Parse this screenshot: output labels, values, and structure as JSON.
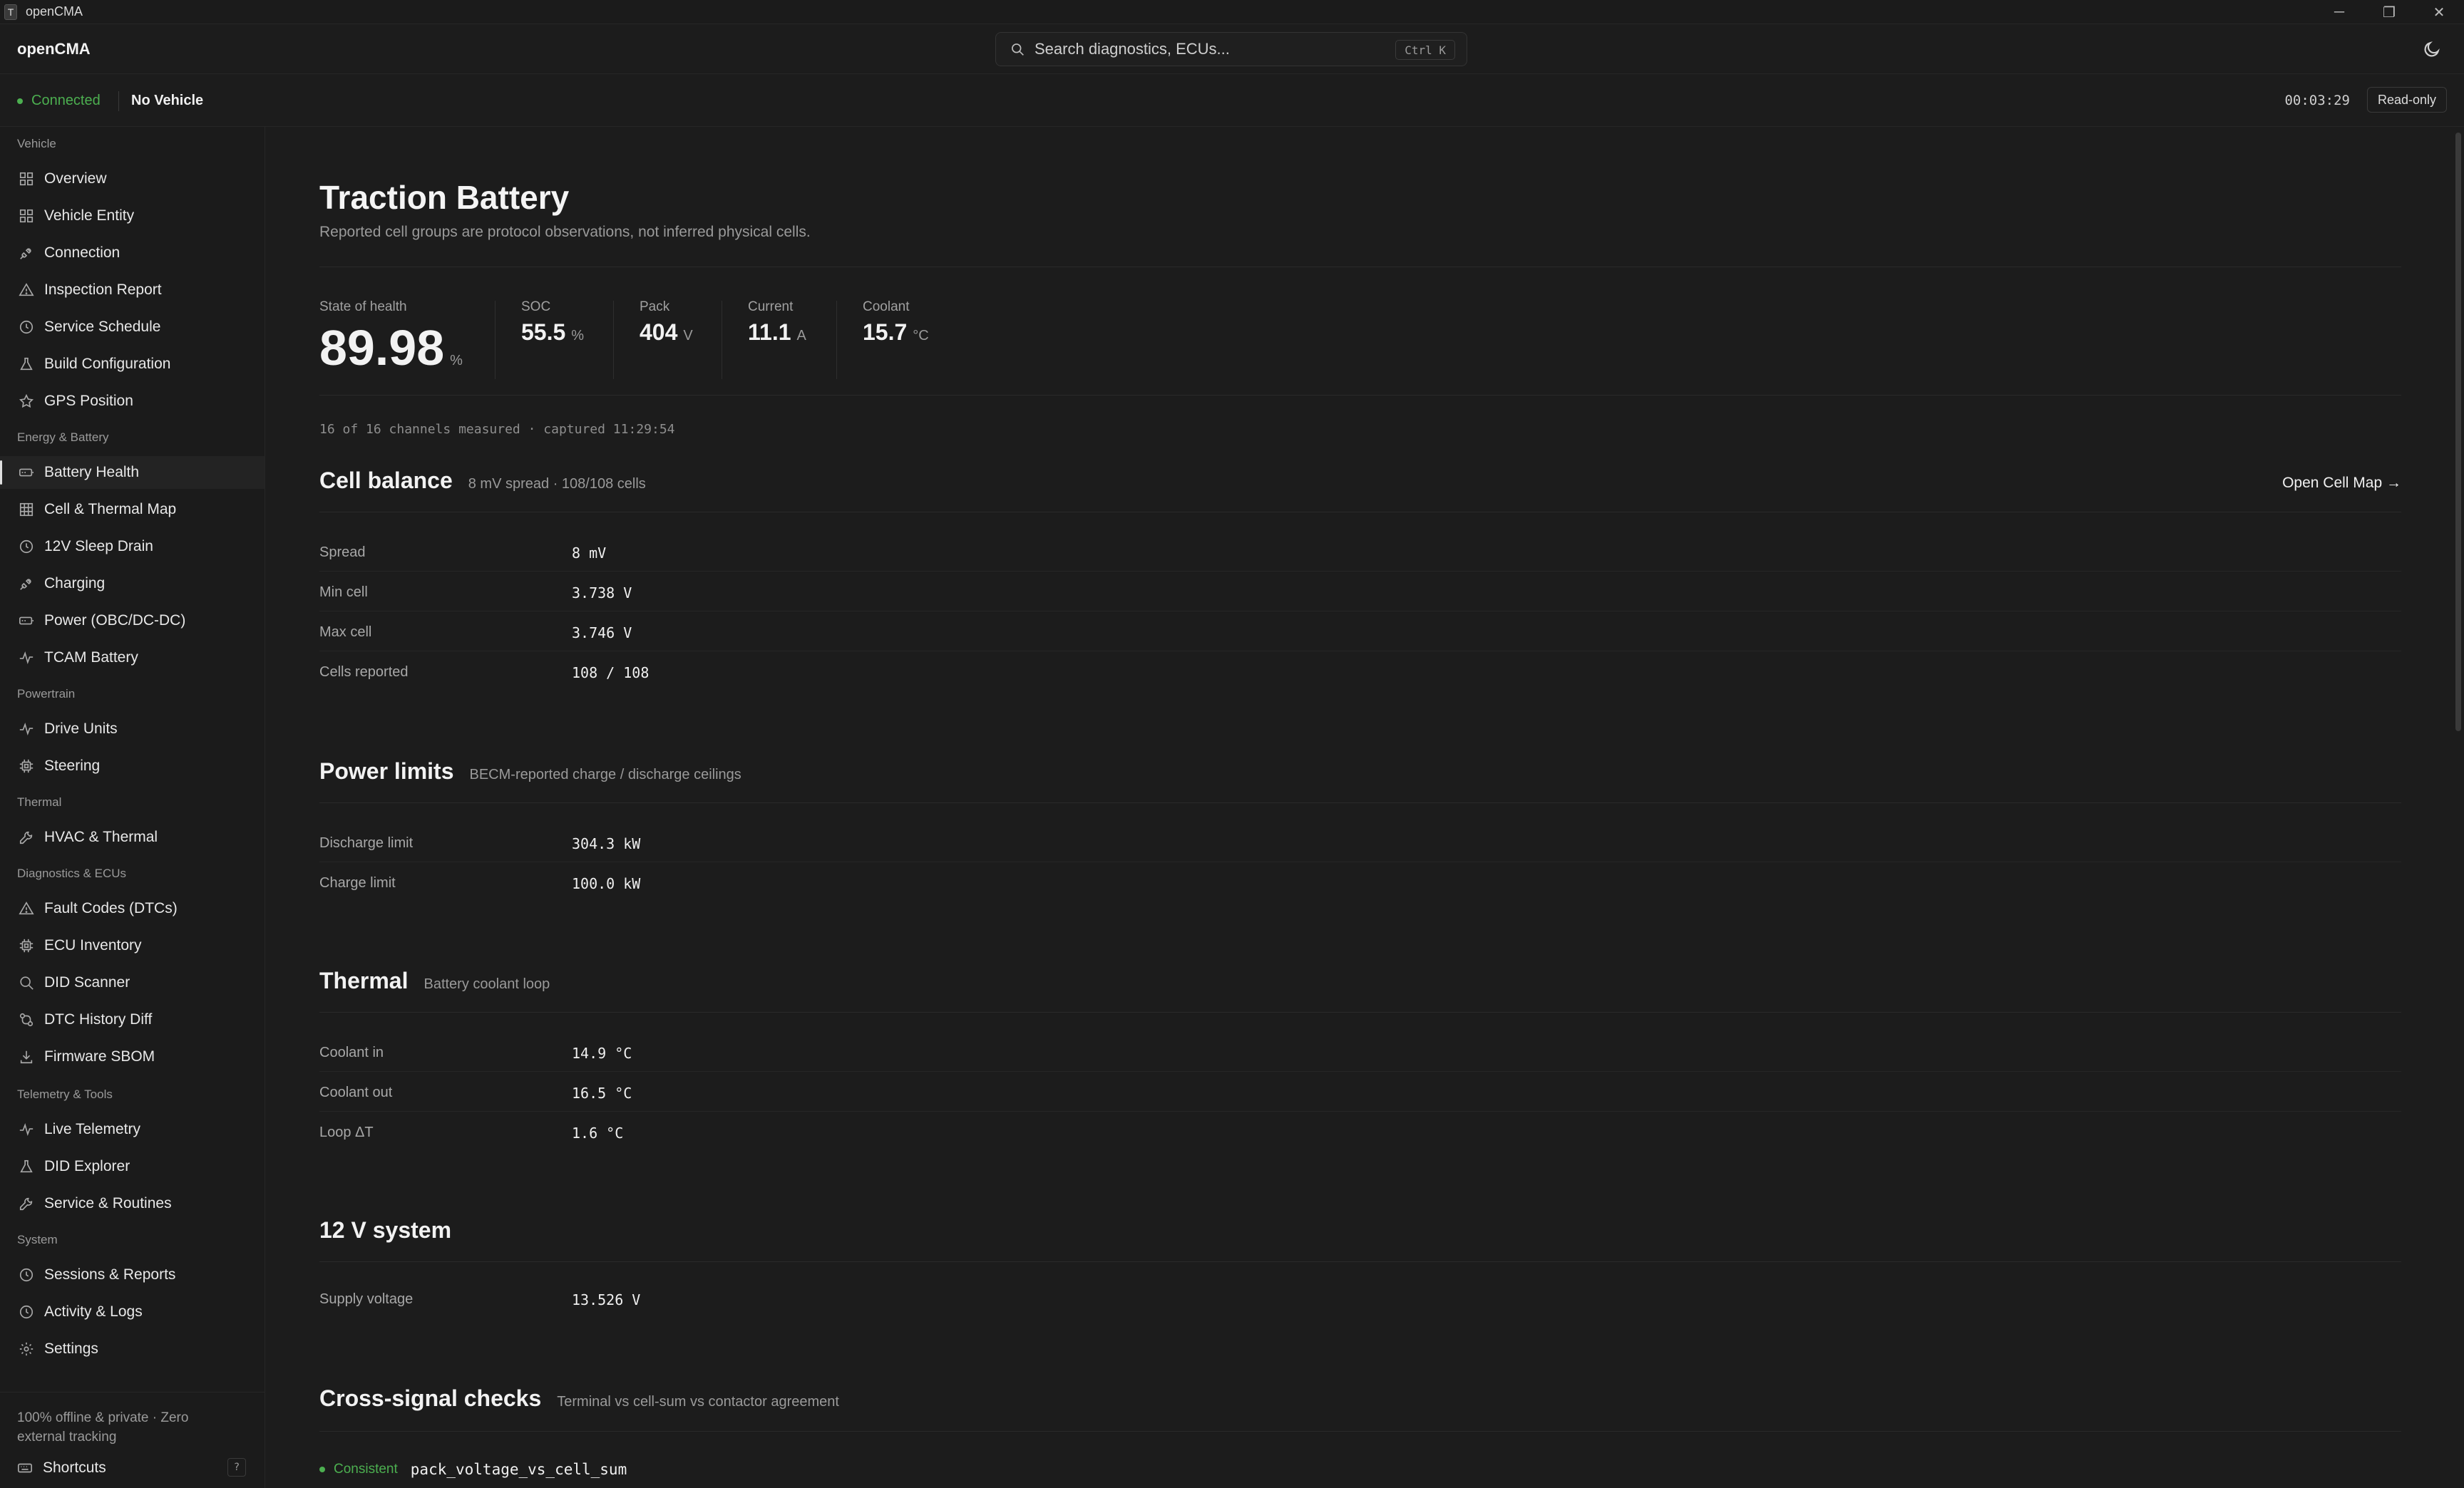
{
  "window": {
    "glyph": "T",
    "title": "openCMA",
    "controls": {
      "minimize": "─",
      "restore": "❐",
      "close": "✕"
    }
  },
  "header": {
    "brand": "openCMA",
    "search_placeholder": "Search diagnostics, ECUs...",
    "search_shortcut": "Ctrl K",
    "theme_icon": "moon-icon"
  },
  "status": {
    "connection": "Connected",
    "vehicle": "No Vehicle",
    "timer": "00:03:29",
    "mode": "Read-only"
  },
  "sidebar": {
    "sections": [
      {
        "label": "Vehicle",
        "items": [
          {
            "label": "Overview",
            "icon": "grid-icon"
          },
          {
            "label": "Vehicle Entity",
            "icon": "grid-icon"
          },
          {
            "label": "Connection",
            "icon": "plug-icon"
          },
          {
            "label": "Inspection Report",
            "icon": "warning-icon"
          },
          {
            "label": "Service Schedule",
            "icon": "clock-icon"
          },
          {
            "label": "Build Configuration",
            "icon": "flask-icon"
          },
          {
            "label": "GPS Position",
            "icon": "star-icon"
          }
        ]
      },
      {
        "label": "Energy & Battery",
        "items": [
          {
            "label": "Battery Health",
            "icon": "battery-icon",
            "active": true
          },
          {
            "label": "Cell & Thermal Map",
            "icon": "table-icon"
          },
          {
            "label": "12V Sleep Drain",
            "icon": "clock-icon"
          },
          {
            "label": "Charging",
            "icon": "plug-icon"
          },
          {
            "label": "Power (OBC/DC-DC)",
            "icon": "battery-icon"
          },
          {
            "label": "TCAM Battery",
            "icon": "activity-icon"
          }
        ]
      },
      {
        "label": "Powertrain",
        "items": [
          {
            "label": "Drive Units",
            "icon": "activity-icon"
          },
          {
            "label": "Steering",
            "icon": "chip-icon"
          }
        ]
      },
      {
        "label": "Thermal",
        "items": [
          {
            "label": "HVAC & Thermal",
            "icon": "wrench-icon"
          }
        ]
      },
      {
        "label": "Diagnostics & ECUs",
        "items": [
          {
            "label": "Fault Codes (DTCs)",
            "icon": "warning-icon"
          },
          {
            "label": "ECU Inventory",
            "icon": "chip-icon"
          },
          {
            "label": "DID Scanner",
            "icon": "search-icon"
          },
          {
            "label": "DTC History Diff",
            "icon": "diff-icon"
          },
          {
            "label": "Firmware SBOM",
            "icon": "download-icon"
          }
        ]
      },
      {
        "label": "Telemetry & Tools",
        "items": [
          {
            "label": "Live Telemetry",
            "icon": "activity-icon"
          },
          {
            "label": "DID Explorer",
            "icon": "flask-icon"
          },
          {
            "label": "Service & Routines",
            "icon": "wrench-icon"
          }
        ]
      },
      {
        "label": "System",
        "items": [
          {
            "label": "Sessions & Reports",
            "icon": "clock-icon"
          },
          {
            "label": "Activity & Logs",
            "icon": "clock-icon"
          },
          {
            "label": "Settings",
            "icon": "gear-icon"
          }
        ]
      }
    ],
    "footer": {
      "privacy": "100% offline & private · Zero external tracking",
      "shortcuts": "Shortcuts",
      "help_key": "?"
    }
  },
  "page": {
    "title": "Traction Battery",
    "subtitle": "Reported cell groups are protocol observations, not inferred physical cells.",
    "metrics": {
      "soh": {
        "label": "State of health",
        "value": "89.98",
        "unit": "%"
      },
      "soc": {
        "label": "SOC",
        "value": "55.5",
        "unit": "%"
      },
      "pack": {
        "label": "Pack",
        "value": "404",
        "unit": "V"
      },
      "current": {
        "label": "Current",
        "value": "11.1",
        "unit": "A"
      },
      "coolant": {
        "label": "Coolant",
        "value": "15.7",
        "unit": "°C"
      }
    },
    "capture_note": "16 of 16 channels measured · captured 11:29:54",
    "cell_balance": {
      "title": "Cell balance",
      "subtitle": "8 mV spread · 108/108 cells",
      "action": "Open Cell Map →",
      "rows": [
        {
          "label": "Spread",
          "value": "8 mV"
        },
        {
          "label": "Min cell",
          "value": "3.738 V"
        },
        {
          "label": "Max cell",
          "value": "3.746 V"
        },
        {
          "label": "Cells reported",
          "value": "108 / 108"
        }
      ]
    },
    "power_limits": {
      "title": "Power limits",
      "subtitle": "BECM-reported charge / discharge ceilings",
      "rows": [
        {
          "label": "Discharge limit",
          "value": "304.3 kW"
        },
        {
          "label": "Charge limit",
          "value": "100.0 kW"
        }
      ]
    },
    "thermal": {
      "title": "Thermal",
      "subtitle": "Battery coolant loop",
      "rows": [
        {
          "label": "Coolant in",
          "value": "14.9 °C"
        },
        {
          "label": "Coolant out",
          "value": "16.5 °C"
        },
        {
          "label": "Loop ΔT",
          "value": "1.6 °C"
        }
      ]
    },
    "system12v": {
      "title": "12 V system",
      "rows": [
        {
          "label": "Supply voltage",
          "value": "13.526 V"
        }
      ]
    },
    "cross_signal": {
      "title": "Cross-signal checks",
      "subtitle": "Terminal vs cell-sum vs contactor agreement",
      "checks": [
        {
          "status": "Consistent",
          "name": "pack_voltage_vs_cell_sum"
        }
      ]
    }
  }
}
